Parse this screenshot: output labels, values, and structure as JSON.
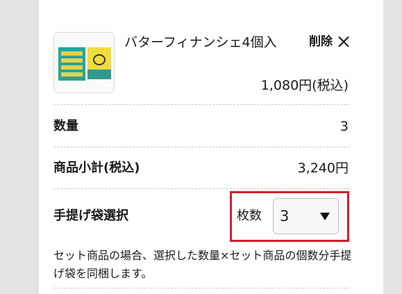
{
  "item": {
    "name": "バターフィナンシェ4個入",
    "remove_label": "削除",
    "price": "1,080円(税込)",
    "thumbnail_icon": "product-package-image"
  },
  "quantity": {
    "label": "数量",
    "value": "3"
  },
  "subtotal": {
    "label": "商品小計(税込)",
    "value": "3,240円"
  },
  "bag": {
    "label": "手提げ袋選択",
    "count_label": "枚数",
    "selected": "3"
  },
  "note": "セット商品の場合、選択した数量×セット商品の個数分手提げ袋を同梱します。",
  "colors": {
    "highlight": "#d31e2a",
    "separator": "#c9c9c9",
    "background": "#e3e3e3"
  }
}
